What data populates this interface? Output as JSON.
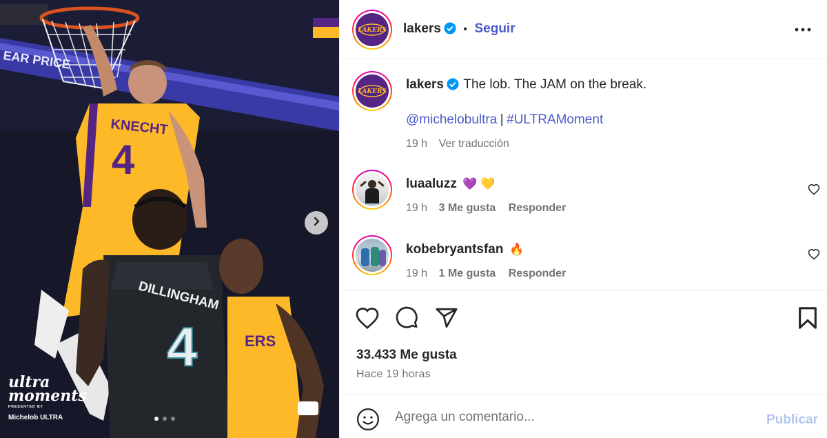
{
  "post": {
    "image_alt": "Knecht dunking",
    "carousel": {
      "active_index": 0,
      "count": 3
    },
    "overlay_texts": {
      "jersey_front": "KNECHT",
      "jersey_front_number": "4",
      "jersey_back": "DILLINGHAM",
      "jersey_back_number": "4",
      "arena_banner": "EAR PRICE",
      "jersey_lakers_partial": "ERS"
    },
    "brand": {
      "line1": "ultra",
      "line2": "moments",
      "line3": "PRESENTED BY",
      "line4": "Michelob ULTRA"
    }
  },
  "header": {
    "username": "lakers",
    "separator": "•",
    "follow_label": "Seguir"
  },
  "caption": {
    "username": "lakers",
    "text": "The lob. The JAM on the break.",
    "mention": "@michelobultra",
    "divider": "|",
    "hashtag": "#ULTRAMoment",
    "age": "19 h",
    "translate_label": "Ver traducción"
  },
  "comments": [
    {
      "username": "luaaluzz",
      "emoji": "💜 💛",
      "age": "19 h",
      "likes": "3 Me gusta",
      "reply_label": "Responder"
    },
    {
      "username": "kobebryantsfan",
      "emoji": "🔥",
      "age": "19 h",
      "likes": "1 Me gusta",
      "reply_label": "Responder"
    }
  ],
  "stats": {
    "likes": "33.433 Me gusta",
    "time": "Hace 19 horas"
  },
  "composer": {
    "placeholder": "Agrega un comentario...",
    "publish_label": "Publicar"
  },
  "colors": {
    "accent_link": "#4a5bc9",
    "lakers_purple": "#552583",
    "lakers_gold": "#fdb927",
    "publish_disabled": "#b3c5ee"
  }
}
